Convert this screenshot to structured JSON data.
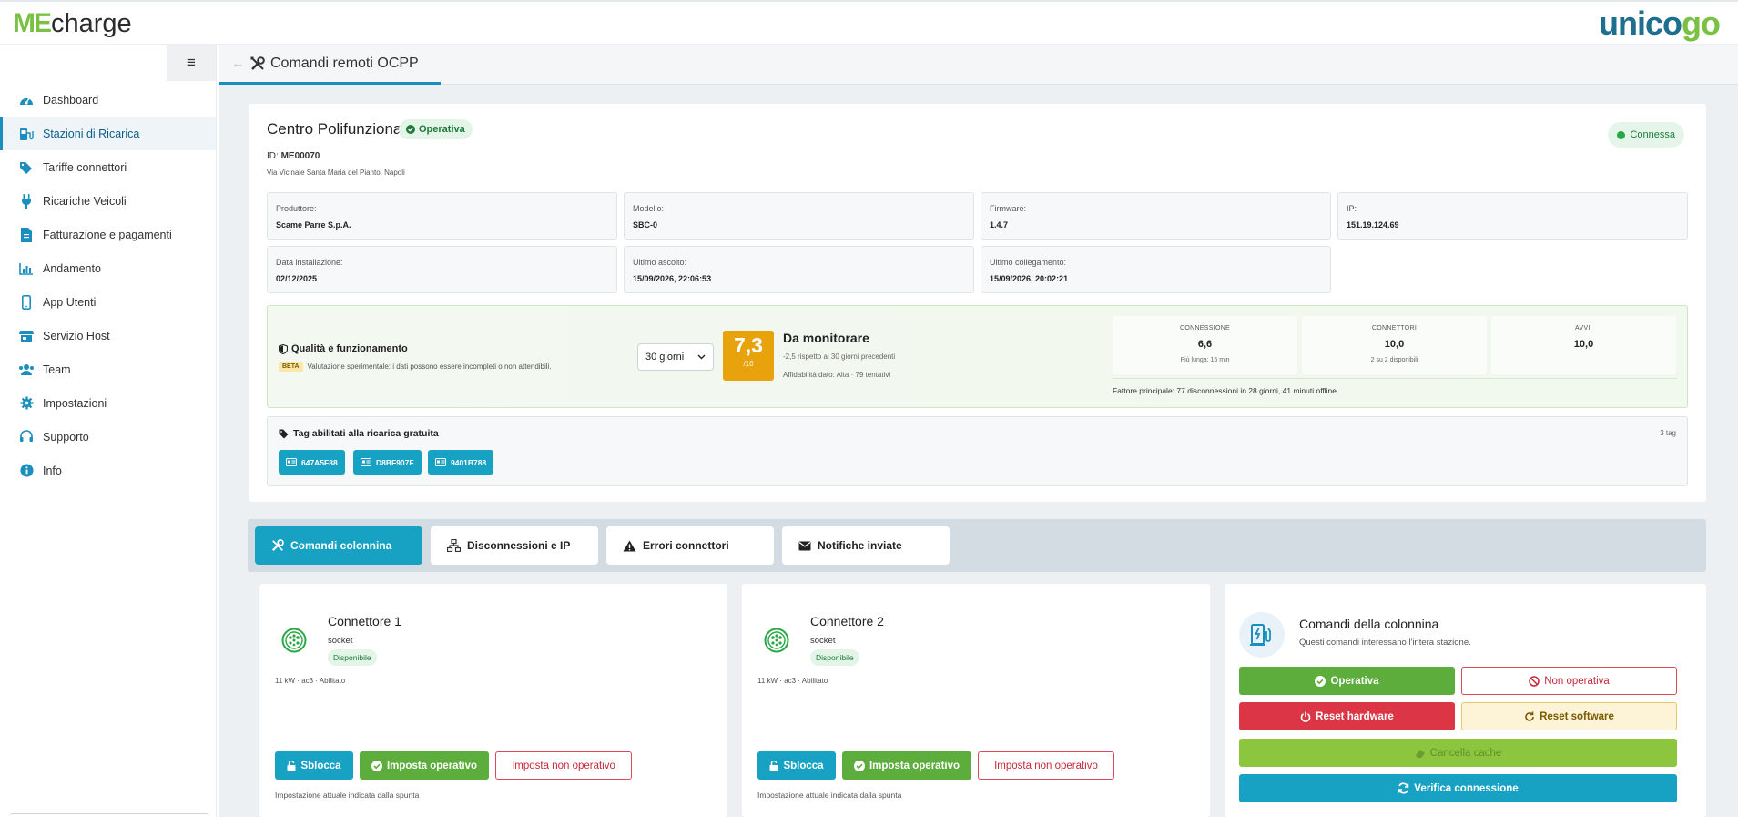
{
  "brand": {
    "logo_prefix": "ME",
    "logo_text": "charge",
    "partner_prefix": "unico",
    "partner_suffix": "go"
  },
  "sidebar": {
    "items": [
      {
        "label": "Dashboard",
        "icon": "dashboard-icon"
      },
      {
        "label": "Stazioni di Ricarica",
        "icon": "charging-station-icon",
        "active": true
      },
      {
        "label": "Tariffe connettori",
        "icon": "tags-icon"
      },
      {
        "label": "Ricariche Veicoli",
        "icon": "plug-icon"
      },
      {
        "label": "Fatturazione e pagamenti",
        "icon": "invoice-icon"
      },
      {
        "label": "Andamento",
        "icon": "chart-icon"
      },
      {
        "label": "App Utenti",
        "icon": "mobile-icon"
      },
      {
        "label": "Servizio Host",
        "icon": "store-icon"
      },
      {
        "label": "Team",
        "icon": "users-icon"
      },
      {
        "label": "Impostazioni",
        "icon": "gear-icon"
      },
      {
        "label": "Supporto",
        "icon": "headset-icon"
      },
      {
        "label": "Info",
        "icon": "info-icon"
      }
    ]
  },
  "header": {
    "title": "Comandi remoti OCPP"
  },
  "station": {
    "name": "Centro Polifunzionale",
    "status": "Operativa",
    "id_label": "ID:",
    "id": "ME00070",
    "address": "Via Vicinale Santa Maria del Pianto, Napoli",
    "connection": "Connessa",
    "info": [
      {
        "label": "Produttore:",
        "value": "Scame Parre S.p.A."
      },
      {
        "label": "Modello:",
        "value": "SBC-0"
      },
      {
        "label": "Firmware:",
        "value": "1.4.7"
      },
      {
        "label": "IP:",
        "value": "151.19.124.69"
      },
      {
        "label": "Data installazione:",
        "value": "02/12/2025"
      },
      {
        "label": "Ultimo ascolto:",
        "value": "15/09/2026, 22:06:53"
      },
      {
        "label": "Ultimo collegamento:",
        "value": "15/09/2026, 20:02:21"
      }
    ]
  },
  "quality": {
    "title": "Qualità e funzionamento",
    "beta": "BETA",
    "beta_text": "Valutazione sperimentale: i dati possono essere incompleti o non attendibili.",
    "period": "30 giorni",
    "score": "7,3",
    "score_scale": "/10",
    "status": "Da monitorare",
    "delta": "-2,5 rispetto ai 30 giorni precedenti",
    "reliability": "Affidabilità dato: Alta · 79 tentativi",
    "metrics": [
      {
        "label": "CONNESSIONE",
        "value": "6,6",
        "sub": "Più lunga: 16 min"
      },
      {
        "label": "CONNETTORI",
        "value": "10,0",
        "sub": "2 su 2 disponibili"
      },
      {
        "label": "AVVII",
        "value": "10,0",
        "sub": ""
      }
    ],
    "factor": "Fattore principale: 77 disconnessioni in 28 giorni, 41 minuti offline"
  },
  "tags": {
    "title": "Tag abilitati alla ricarica gratuita",
    "count": "3 tag",
    "items": [
      "647A5F88",
      "D8BF907F",
      "9401B788"
    ]
  },
  "tabs": [
    {
      "label": "Comandi colonnina",
      "icon": "tools-icon",
      "active": true
    },
    {
      "label": "Disconnessioni e IP",
      "icon": "network-icon"
    },
    {
      "label": "Errori connettori",
      "icon": "warning-icon"
    },
    {
      "label": "Notifiche inviate",
      "icon": "envelope-icon"
    }
  ],
  "connectors": [
    {
      "name": "Connettore 1",
      "type": "socket",
      "status": "Disponibile",
      "spec": "11 kW · ac3 · Abilitato"
    },
    {
      "name": "Connettore 2",
      "type": "socket",
      "status": "Disponibile",
      "spec": "11 kW · ac3 · Abilitato"
    }
  ],
  "connector_actions": {
    "unlock": "Sblocca",
    "set_operative": "Imposta operativo",
    "set_inoperative": "Imposta non operativo",
    "hint": "Impostazione attuale indicata dalla spunta"
  },
  "station_commands": {
    "title": "Comandi della colonnina",
    "subtitle": "Questi comandi interessano l'intera stazione.",
    "operative": "Operativa",
    "inoperative": "Non operativa",
    "reset_hw": "Reset hardware",
    "reset_sw": "Reset software",
    "clear_cache": "Cancella cache",
    "verify": "Verifica connessione"
  },
  "colors": {
    "accent": "#17a2c4",
    "success": "#5cad3c",
    "danger": "#dc3545",
    "warning": "#e8a20c",
    "brand_green": "#7ac143",
    "brand_blue": "#1e6e8e"
  }
}
